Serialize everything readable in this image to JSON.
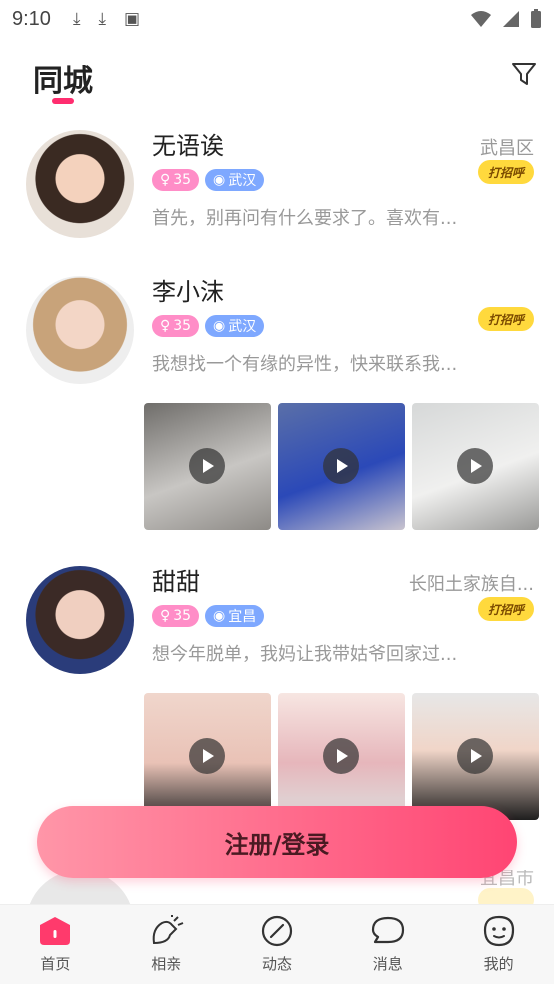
{
  "status": {
    "time": "9:10"
  },
  "header": {
    "title": "同城"
  },
  "users": [
    {
      "name": "无语诶",
      "location": "武昌区",
      "age": "35",
      "city": "武汉",
      "greet": "打招呼",
      "bio": "首先，别再问有什么要求了。喜欢有..."
    },
    {
      "name": "李小沫",
      "location": "",
      "age": "35",
      "city": "武汉",
      "greet": "打招呼",
      "bio": "我想找一个有缘的异性，快来联系我..."
    },
    {
      "name": "甜甜",
      "location": "长阳土家族自...",
      "age": "35",
      "city": "宜昌",
      "greet": "打招呼",
      "bio": "想今年脱单，我妈让我带姑爷回家过..."
    }
  ],
  "partial": {
    "location": "宜昌市"
  },
  "login_button": "注册/登录",
  "tabs": [
    {
      "label": "首页",
      "icon": "home-icon"
    },
    {
      "label": "相亲",
      "icon": "matchmaking-icon"
    },
    {
      "label": "动态",
      "icon": "moments-icon"
    },
    {
      "label": "消息",
      "icon": "message-icon"
    },
    {
      "label": "我的",
      "icon": "profile-icon"
    }
  ],
  "colors": {
    "accent": "#ff2d6f",
    "age_tag": "#ff8dc7",
    "city_tag": "#7ea8ff",
    "greet": "#ffd93d"
  }
}
